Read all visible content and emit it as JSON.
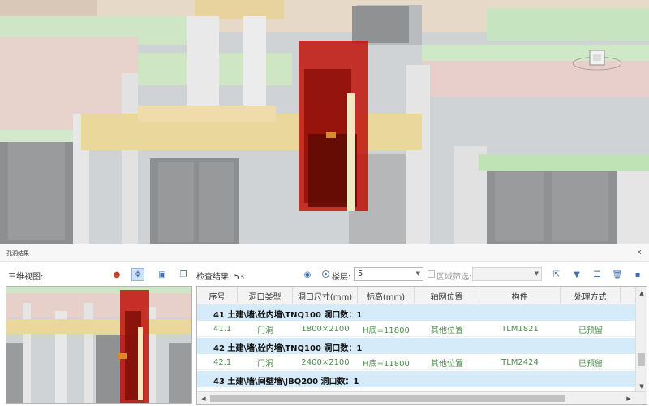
{
  "panel": {
    "title": "孔洞结果",
    "close_label": "x"
  },
  "toolbar": {
    "view_label": "三维视图:",
    "result_label": "检查结果: 53",
    "floor_label": "楼层:",
    "floor_value": "5",
    "region_label": "区域筛选:",
    "region_value": "",
    "icons": [
      "color-icon",
      "fit-view-icon",
      "select-icon",
      "copy-icon",
      "eye-icon",
      "export-icon",
      "filter-icon",
      "list-icon",
      "delete-icon",
      "save-icon"
    ]
  },
  "table": {
    "columns": [
      "序号",
      "洞口类型",
      "洞口尺寸(mm)",
      "标高(mm)",
      "轴网位置",
      "构件",
      "处理方式"
    ],
    "groups": [
      {
        "label": "41   土建\\墙\\砼内墙\\TNQ100   洞口数：1",
        "rows": [
          [
            "41.1",
            "门洞",
            "1800×2100",
            "H底=11800",
            "其他位置",
            "TLM1821",
            "已预留"
          ]
        ]
      },
      {
        "label": "42   土建\\墙\\砼内墙\\TNQ100   洞口数：1",
        "rows": [
          [
            "42.1",
            "门洞",
            "2400×2100",
            "H底=11800",
            "其他位置",
            "TLM2424",
            "已预留"
          ]
        ]
      },
      {
        "label": "43   土建\\墙\\间壁墙\\JBQ200   洞口数：1",
        "rows": []
      }
    ]
  },
  "colors": {
    "group_bg": "#d5ebfa",
    "row_text": "#4a8e4a",
    "highlight": "#c0130a"
  }
}
